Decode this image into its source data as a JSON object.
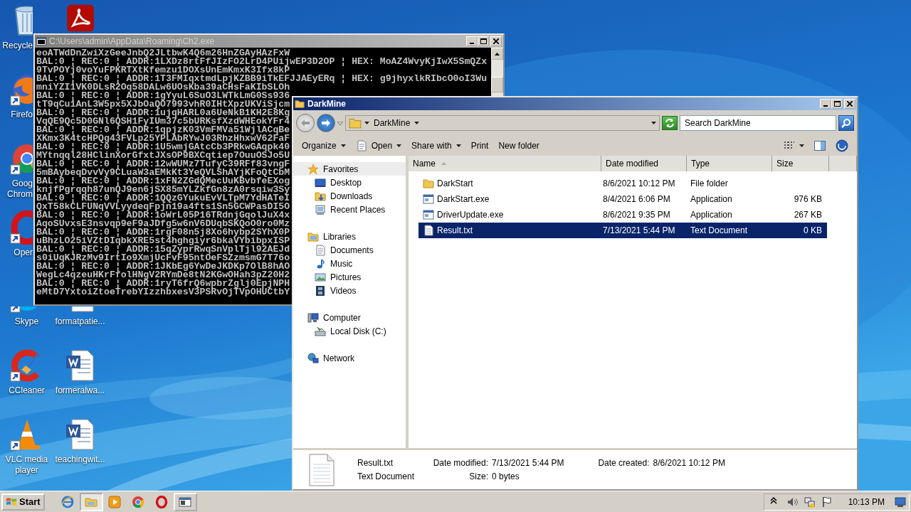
{
  "desktop": {
    "columns": [
      [
        {
          "kind": "recycle",
          "label": "Recycle"
        },
        {
          "kind": "firefox",
          "label": "Firefo"
        },
        {
          "kind": "chrome",
          "label": "Goog\nChrom"
        },
        {
          "kind": "opera",
          "label": "Oper"
        },
        {
          "kind": "skype",
          "label": "Skype"
        },
        {
          "kind": "ccleaner",
          "label": "CCleaner"
        },
        {
          "kind": "vlc",
          "label": "VLC media player"
        }
      ],
      [
        {
          "kind": "acrobat"
        },
        {
          "kind": "word",
          "label": "formatpatie..."
        },
        {
          "kind": "word",
          "label": "formeralwa..."
        },
        {
          "kind": "word",
          "label": "teachingwit..."
        }
      ]
    ]
  },
  "console": {
    "title": "C:\\Users\\admin\\AppData\\Roaming\\Ch2.exe",
    "lines": [
      "eoATWdDnZwiXzGeeJnbQ2JLtbwK4Q6m26HnZGAyHAzFxW",
      "BAL:0 ¦ REC:0 ¦ ADDR:1LXDz8rtFfJIzFO2LrD4PUijwEP3D2OP ¦ HEX: MoAZ4WvyKjIwX5SmQZx",
      "9TvPOYj0voYuFPKRTXtKfemzu1DOXsUnEmKmxK3Ifx8kP",
      "BAL:0 ¦ REC:0 ¦ ADDR:1T3FMIqxtmdLpjKZBB9iTkEFJJAEyERq ¦ HEX: g9jhyxlkRIbcO0oI3Wu",
      "mniYZI1VK0DLsR2Oq58DALw6UOsKba39aCHsFaKIbSLOh",
      "BAL:0 ¦ REC:0 ¦ ADDR:1gYyuL6SuO3LWTkLmG0Ss936",
      "tT9qCu1AnL3W5px5XJbOaQO7993vhR0IHtXpzUKViSjcm",
      "BAL:0 ¦ REC:0 ¦ ADDR:1ujqHARL0a6UeNkB1KH2E8Kg",
      "VqQE9Qc5D0GNl6QSH1FyIUm37c5bURKsfXzdWHEokYFr4",
      "BAL:0 ¦ REC:0 ¦ ADDR:1qpjzK03VmFMVa51WjlACqBe",
      "XKmx3K4tcHPQg43FVLp25YPLAbRYwJ03RhzHhxwV62FaF",
      "BAL:0 ¦ REC:0 ¦ ADDR:1U5wmjGAtcCb3PRkwGAqpk40",
      "MYtnqql28HClinXorGfxtJXsOP9BXCqtiep7OuuOSJo5U",
      "BAL:0 ¦ REC:0 ¦ ADDR:12wWUMz7TufyC39RFf83vngF",
      "5mBAybeqDvvVy9CLuaW3aEMkKt3YeQVLShAYjKFoQtCbM",
      "BAL:0 ¦ REC:0 ¦ ADDR:1xFN2ZGdQMecUuKBvbfeEXog",
      "knjfPgrqqh87unQJ9en6jSX85mYLZkfGn8zA0rsqiw3Sy",
      "BAL:0 ¦ REC:0 ¦ ADDR:1QQzGYukuEvVLTpM7YdHATeI",
      "QxT58kCLFUNqVVLyydeqFpjn19a4fts1Sn5GCWPasDI5O",
      "BAL:0 ¦ REC:0 ¦ ADDR:1oWrL05P16TRdnjGqolJuX4x",
      "AqoSUvxsE3nsvqp9eF9aJDfg5w6nV6DUqbSKQoO0ro0Mz",
      "BAL:0 ¦ REC:0 ¦ ADDR:1rgF08n5j8Xo6hybp2SYhX0P",
      "uBhzLO25iVZtDIqbkXRE5st4hghgiyr6bkaVYbibpxISP",
      "BAL:0 ¦ REC:0 ¦ ADDR:15qZyprRwqSnVplTjl92AEJd",
      "s0iUqKJRzMv9IrtIo9XmjUcFvF95ntOeFSZzmsmG7T76o",
      "BAL:0 ¦ REC:0 ¦ ADDR:1JKbEg6YwDeJKDKp7OlB8hAO",
      "WegLc4qzeuHKrFfolHNgV2RYmDe8tN2KGwOHah3pZ20H2",
      "BAL:0 ¦ REC:0 ¦ ADDR:1ryT6frQ6wpbrZglj0EpjNPH",
      "eMtD7YxtoiZtoeTrebYIzzhbxesV3PSRvOjTVpOHUCtbY"
    ]
  },
  "explorer": {
    "title": "DarkMine",
    "breadcrumb": "DarkMine",
    "search": {
      "placeholder": "Search DarkMine"
    },
    "toolbar": [
      {
        "label": "Organize",
        "kind": "menu"
      },
      {
        "label": "Open",
        "kind": "open"
      },
      {
        "label": "Share with",
        "kind": "menu"
      },
      {
        "label": "Print",
        "kind": "plain"
      },
      {
        "label": "New folder",
        "kind": "plain"
      }
    ],
    "nav": [
      {
        "label": "Favorites",
        "kind": "favorites",
        "selected": true,
        "children": [
          {
            "label": "Desktop",
            "kind": "desktop",
            "selected": false
          },
          {
            "label": "Downloads",
            "kind": "downloads",
            "selected": false
          },
          {
            "label": "Recent Places",
            "kind": "recent",
            "selected": false
          }
        ]
      },
      {
        "label": "Libraries",
        "kind": "libraries",
        "selected": false,
        "children": [
          {
            "label": "Documents",
            "kind": "documents",
            "selected": false
          },
          {
            "label": "Music",
            "kind": "music",
            "selected": false
          },
          {
            "label": "Pictures",
            "kind": "pictures",
            "selected": false
          },
          {
            "label": "Videos",
            "kind": "videos",
            "selected": false
          }
        ]
      },
      {
        "label": "Computer",
        "kind": "computer",
        "selected": false,
        "children": [
          {
            "label": "Local Disk (C:)",
            "kind": "disk",
            "selected": false
          }
        ]
      },
      {
        "label": "Network",
        "kind": "network",
        "selected": false
      }
    ],
    "columns": [
      {
        "label": "Name",
        "sorted": true
      },
      {
        "label": "Date modified",
        "sorted": false
      },
      {
        "label": "Type",
        "sorted": false
      },
      {
        "label": "Size",
        "sorted": false
      }
    ],
    "files": [
      {
        "name": "DarkStart",
        "date": "8/6/2021 10:12 PM",
        "type": "File folder",
        "kind": "folder",
        "selected": false
      },
      {
        "name": "DarkStart.exe",
        "date": "8/4/2021 6:06 PM",
        "type": "Application",
        "size": "976 KB",
        "kind": "exe",
        "selected": false
      },
      {
        "name": "DriverUpdate.exe",
        "date": "8/6/2021 9:35 PM",
        "type": "Application",
        "size": "267 KB",
        "kind": "exe",
        "selected": false
      },
      {
        "name": "Result.txt",
        "date": "7/13/2021 5:44 PM",
        "type": "Text Document",
        "size": "0 KB",
        "kind": "text",
        "selected": true
      }
    ],
    "details": {
      "kind": "text",
      "name": "Result.txt",
      "type": "Text Document",
      "fields": [
        {
          "label": "Date modified:",
          "value": "7/13/2021 5:44 PM"
        },
        {
          "label": "Size:",
          "value": "0 bytes"
        },
        {
          "label": "Date created:",
          "value": "8/6/2021 10:12 PM"
        }
      ]
    }
  },
  "taskbar": {
    "start": "Start",
    "apps": [
      {
        "kind": "ie",
        "running": false,
        "selected": false
      },
      {
        "kind": "explorer",
        "running": true,
        "selected": true
      },
      {
        "kind": "media",
        "running": false,
        "selected": false
      },
      {
        "kind": "chrome",
        "running": false,
        "selected": false
      },
      {
        "kind": "opera",
        "running": false,
        "selected": false
      },
      {
        "kind": "console",
        "running": true,
        "selected": false
      }
    ],
    "clock": "10:13 PM"
  }
}
